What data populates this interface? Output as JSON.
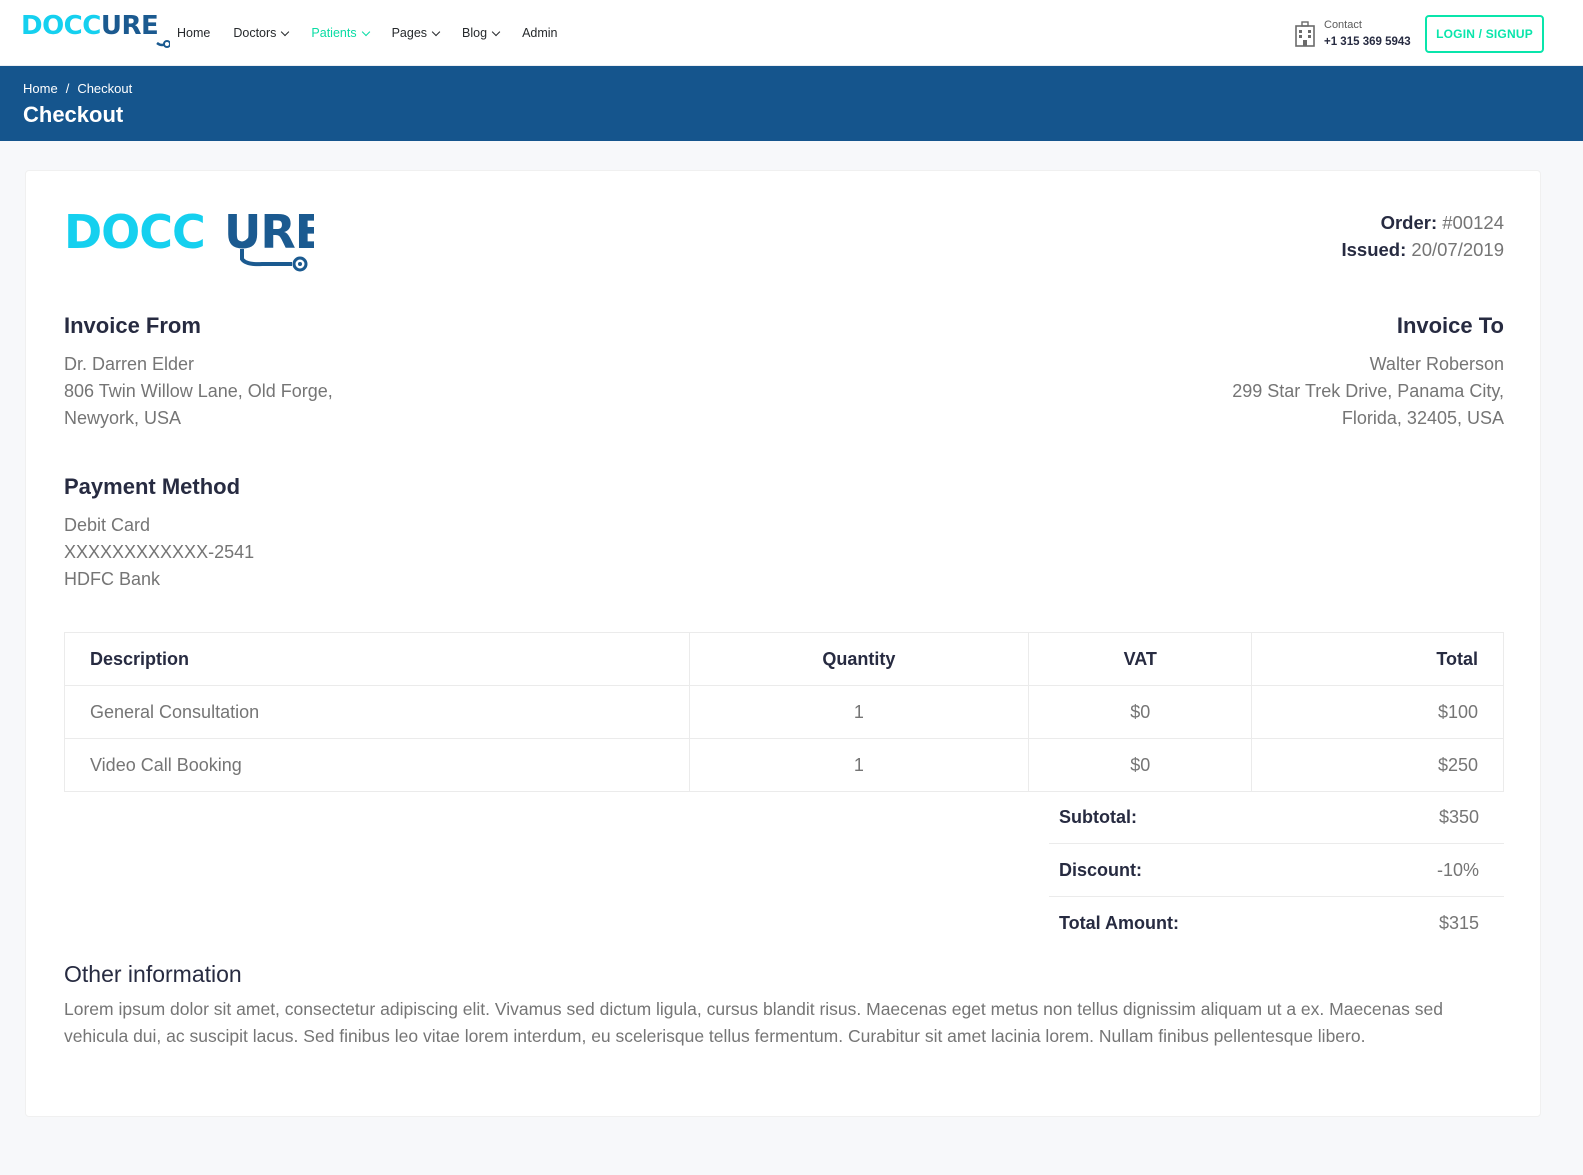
{
  "brand": {
    "part1": "DOCC",
    "part2": "URE",
    "color_primary": "#15d0ef",
    "color_secondary": "#1b5a90"
  },
  "nav": {
    "items": [
      {
        "label": "Home",
        "dropdown": false,
        "active": false
      },
      {
        "label": "Doctors",
        "dropdown": true,
        "active": false
      },
      {
        "label": "Patients",
        "dropdown": true,
        "active": true
      },
      {
        "label": "Pages",
        "dropdown": true,
        "active": false
      },
      {
        "label": "Blog",
        "dropdown": true,
        "active": false
      },
      {
        "label": "Admin",
        "dropdown": false,
        "active": false
      }
    ]
  },
  "contact": {
    "label": "Contact",
    "phone": "+1 315 369 5943",
    "icon": "hospital-building-icon"
  },
  "auth": {
    "button_label": "LOGIN / SIGNUP"
  },
  "breadcrumb": {
    "home": "Home",
    "separator": "/",
    "current": "Checkout",
    "title": "Checkout"
  },
  "invoice": {
    "order_label": "Order:",
    "order_number": "#00124",
    "issued_label": "Issued:",
    "issued_date": "20/07/2019",
    "from": {
      "title": "Invoice From",
      "lines": [
        "Dr. Darren Elder",
        "806 Twin Willow Lane, Old Forge,",
        "Newyork, USA"
      ]
    },
    "to": {
      "title": "Invoice To",
      "lines": [
        "Walter Roberson",
        "299 Star Trek Drive, Panama City,",
        "Florida, 32405, USA"
      ]
    },
    "payment": {
      "title": "Payment Method",
      "lines": [
        "Debit Card",
        "XXXXXXXXXXXX-2541",
        "HDFC Bank"
      ]
    },
    "table": {
      "headers": [
        "Description",
        "Quantity",
        "VAT",
        "Total"
      ],
      "rows": [
        [
          "General Consultation",
          "1",
          "$0",
          "$100"
        ],
        [
          "Video Call Booking",
          "1",
          "$0",
          "$250"
        ]
      ]
    },
    "totals": [
      {
        "label": "Subtotal:",
        "value": "$350"
      },
      {
        "label": "Discount:",
        "value": "-10%"
      },
      {
        "label": "Total Amount:",
        "value": "$315"
      }
    ],
    "other": {
      "title": "Other information",
      "text": "Lorem ipsum dolor sit amet, consectetur adipiscing elit. Vivamus sed dictum ligula, cursus blandit risus. Maecenas eget metus non tellus dignissim aliquam ut a ex. Maecenas sed vehicula dui, ac suscipit lacus. Sed finibus leo vitae lorem interdum, eu scelerisque tellus fermentum. Curabitur sit amet lacinia lorem. Nullam finibus pellentesque libero."
    }
  },
  "colors": {
    "accent": "#09e5ab",
    "header_bar": "#15558d",
    "text_dark": "#272b41",
    "text_muted": "#757575"
  }
}
